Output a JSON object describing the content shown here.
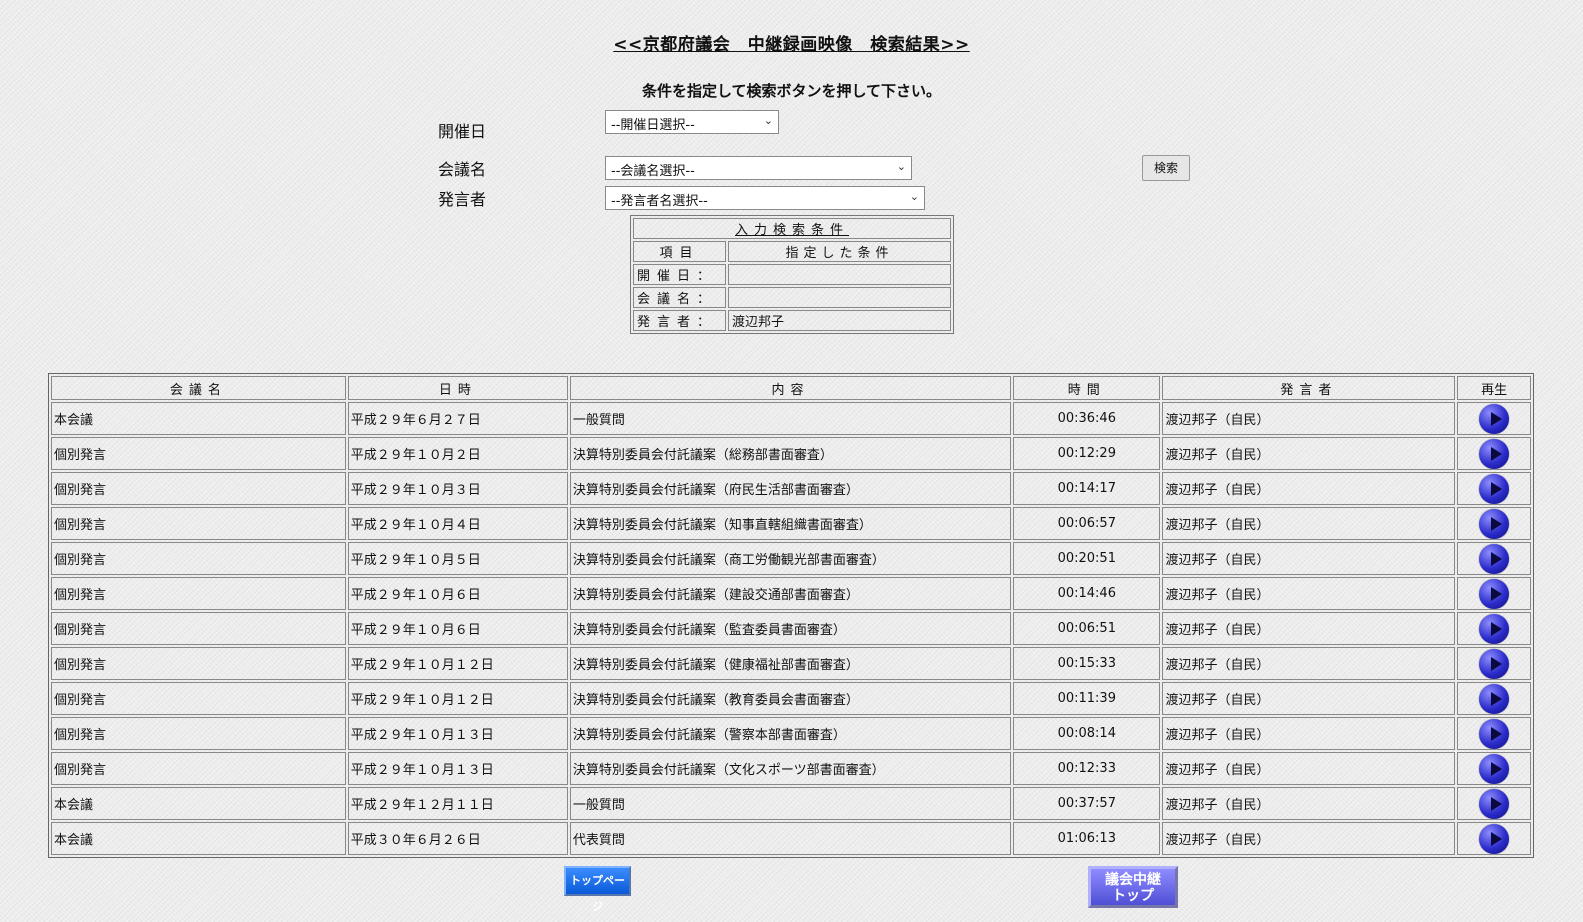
{
  "header": {
    "title": "<<京都府議会　中継録画映像　検索結果>>",
    "instruction": "条件を指定して検索ボタンを押して下さい。"
  },
  "form": {
    "date_label": "開催日",
    "date_select": "--開催日選択--",
    "meeting_label": "会議名",
    "meeting_select": "--会議名選択--",
    "speaker_label": "発言者",
    "speaker_select": "--発言者名選択--",
    "search_button": "検索"
  },
  "conditions": {
    "title": "入力検索条件",
    "col_item": "項目",
    "col_value": "指定した条件",
    "rows": [
      {
        "key": "開催日：",
        "value": ""
      },
      {
        "key": "会議名：",
        "value": ""
      },
      {
        "key": "発言者：",
        "value": "渡辺邦子"
      }
    ]
  },
  "results": {
    "headers": [
      "会議名",
      "日時",
      "内容",
      "時間",
      "発言者",
      "再生"
    ],
    "rows": [
      {
        "meeting": "本会議",
        "date": "平成２９年６月２７日",
        "content": "一般質問",
        "time": "00:36:46",
        "speaker": "渡辺邦子（自民）"
      },
      {
        "meeting": "個別発言",
        "date": "平成２９年１０月２日",
        "content": "決算特別委員会付託議案（総務部書面審査）",
        "time": "00:12:29",
        "speaker": "渡辺邦子（自民）"
      },
      {
        "meeting": "個別発言",
        "date": "平成２９年１０月３日",
        "content": "決算特別委員会付託議案（府民生活部書面審査）",
        "time": "00:14:17",
        "speaker": "渡辺邦子（自民）"
      },
      {
        "meeting": "個別発言",
        "date": "平成２９年１０月４日",
        "content": "決算特別委員会付託議案（知事直轄組織書面審査）",
        "time": "00:06:57",
        "speaker": "渡辺邦子（自民）"
      },
      {
        "meeting": "個別発言",
        "date": "平成２９年１０月５日",
        "content": "決算特別委員会付託議案（商工労働観光部書面審査）",
        "time": "00:20:51",
        "speaker": "渡辺邦子（自民）"
      },
      {
        "meeting": "個別発言",
        "date": "平成２９年１０月６日",
        "content": "決算特別委員会付託議案（建設交通部書面審査）",
        "time": "00:14:46",
        "speaker": "渡辺邦子（自民）"
      },
      {
        "meeting": "個別発言",
        "date": "平成２９年１０月６日",
        "content": "決算特別委員会付託議案（監査委員書面審査）",
        "time": "00:06:51",
        "speaker": "渡辺邦子（自民）"
      },
      {
        "meeting": "個別発言",
        "date": "平成２９年１０月１２日",
        "content": "決算特別委員会付託議案（健康福祉部書面審査）",
        "time": "00:15:33",
        "speaker": "渡辺邦子（自民）"
      },
      {
        "meeting": "個別発言",
        "date": "平成２９年１０月１２日",
        "content": "決算特別委員会付託議案（教育委員会書面審査）",
        "time": "00:11:39",
        "speaker": "渡辺邦子（自民）"
      },
      {
        "meeting": "個別発言",
        "date": "平成２９年１０月１３日",
        "content": "決算特別委員会付託議案（警察本部書面審査）",
        "time": "00:08:14",
        "speaker": "渡辺邦子（自民）"
      },
      {
        "meeting": "個別発言",
        "date": "平成２９年１０月１３日",
        "content": "決算特別委員会付託議案（文化スポーツ部書面審査）",
        "time": "00:12:33",
        "speaker": "渡辺邦子（自民）"
      },
      {
        "meeting": "本会議",
        "date": "平成２９年１２月１１日",
        "content": "一般質問",
        "time": "00:37:57",
        "speaker": "渡辺邦子（自民）"
      },
      {
        "meeting": "本会議",
        "date": "平成３０年６月２６日",
        "content": "代表質問",
        "time": "01:06:13",
        "speaker": "渡辺邦子（自民）"
      }
    ],
    "play_icon": "play-icon"
  },
  "footer": {
    "top_page_button": "トップページ",
    "gikai_button_line1": "議会中継",
    "gikai_button_line2": "トップ"
  }
}
